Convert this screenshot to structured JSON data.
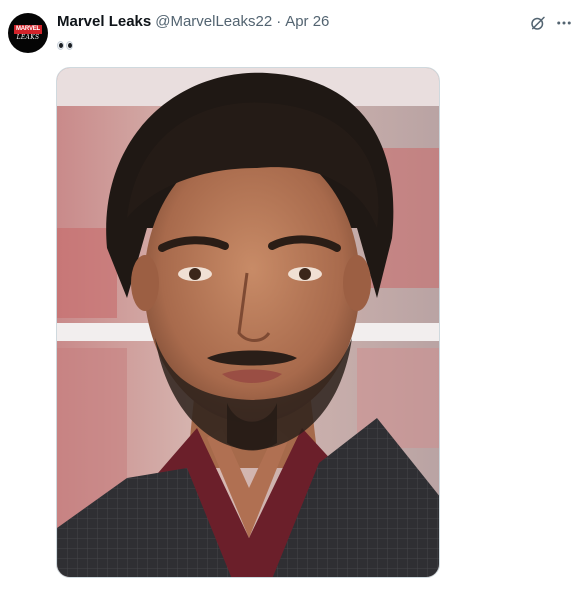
{
  "author": {
    "display_name": "Marvel Leaks",
    "handle": "@MarvelLeaks22",
    "avatar": {
      "logo_top": "MARVEL",
      "logo_bottom": "LEAKS",
      "logo_top_color": "#d2232a",
      "background": "#050505"
    }
  },
  "meta": {
    "separator": "·",
    "date": "Apr 26"
  },
  "tweet": {
    "emoji": "eyes-emoji"
  },
  "actions": {
    "grok_icon": "grok-icon",
    "more_icon": "more-horizontal-icon"
  },
  "media": {
    "kind": "photo",
    "subject": "portrait-photo"
  },
  "colors": {
    "text_primary": "#0f1419",
    "text_secondary": "#536471",
    "border": "#cfd9de"
  }
}
